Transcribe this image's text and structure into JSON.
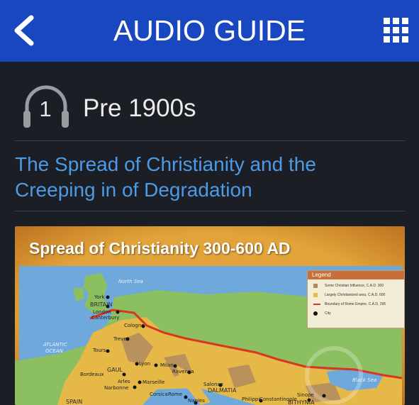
{
  "header": {
    "title": "AUDIO GUIDE",
    "back_icon": "chevron-left-icon",
    "menu_icon": "grid-icon",
    "bg_color": "#1947bf"
  },
  "track": {
    "number": "1",
    "label": "Pre 1900s",
    "icon": "headphones-icon"
  },
  "article": {
    "title_line1": "The Spread of Christianity and the",
    "title_line2": "Creeping in of Degradation",
    "accent_color": "#4d9ae6"
  },
  "map": {
    "title": "Spread of Christianity 300-600 AD",
    "legend": {
      "title": "Legend",
      "items": [
        {
          "label": "Some Christian Influence, C.A.D. 300",
          "color": "#b08a62"
        },
        {
          "label": "Largely Christianized area, C.A.D. 600",
          "color": "#e6b847"
        },
        {
          "label": "Boundary of Rome Empire, C.A.D. 395",
          "color": "#d9361f"
        },
        {
          "label": "City",
          "color": "#111111"
        }
      ]
    },
    "labels": {
      "north_sea": "North Sea",
      "atlantic": "ATLANTIC",
      "ocean": "OCEAN",
      "black_sea": "Black Sea",
      "britain": "BRITAIN",
      "york": "York",
      "london": "London",
      "canterbury": "Canterbury",
      "cologne": "Cologne",
      "treves": "Treves",
      "tours": "Tours",
      "gaul": "GAUL",
      "lyon": "Lyon",
      "milan": "Milan",
      "bordeaux": "Bordeaux",
      "arles": "Arles",
      "marseille": "Marseille",
      "narbonne": "Narbonne",
      "ravenna": "Ravenna",
      "salonae": "Salonae",
      "dalmatia": "DALMATIA",
      "corsica": "Corsica",
      "rome": "Rome",
      "naples": "Naples",
      "philippi": "Philippi",
      "constantinople": "Constantinople",
      "sinope": "Sinope",
      "bithynia": "BITHYNIA",
      "spain": "SPAIN"
    }
  }
}
